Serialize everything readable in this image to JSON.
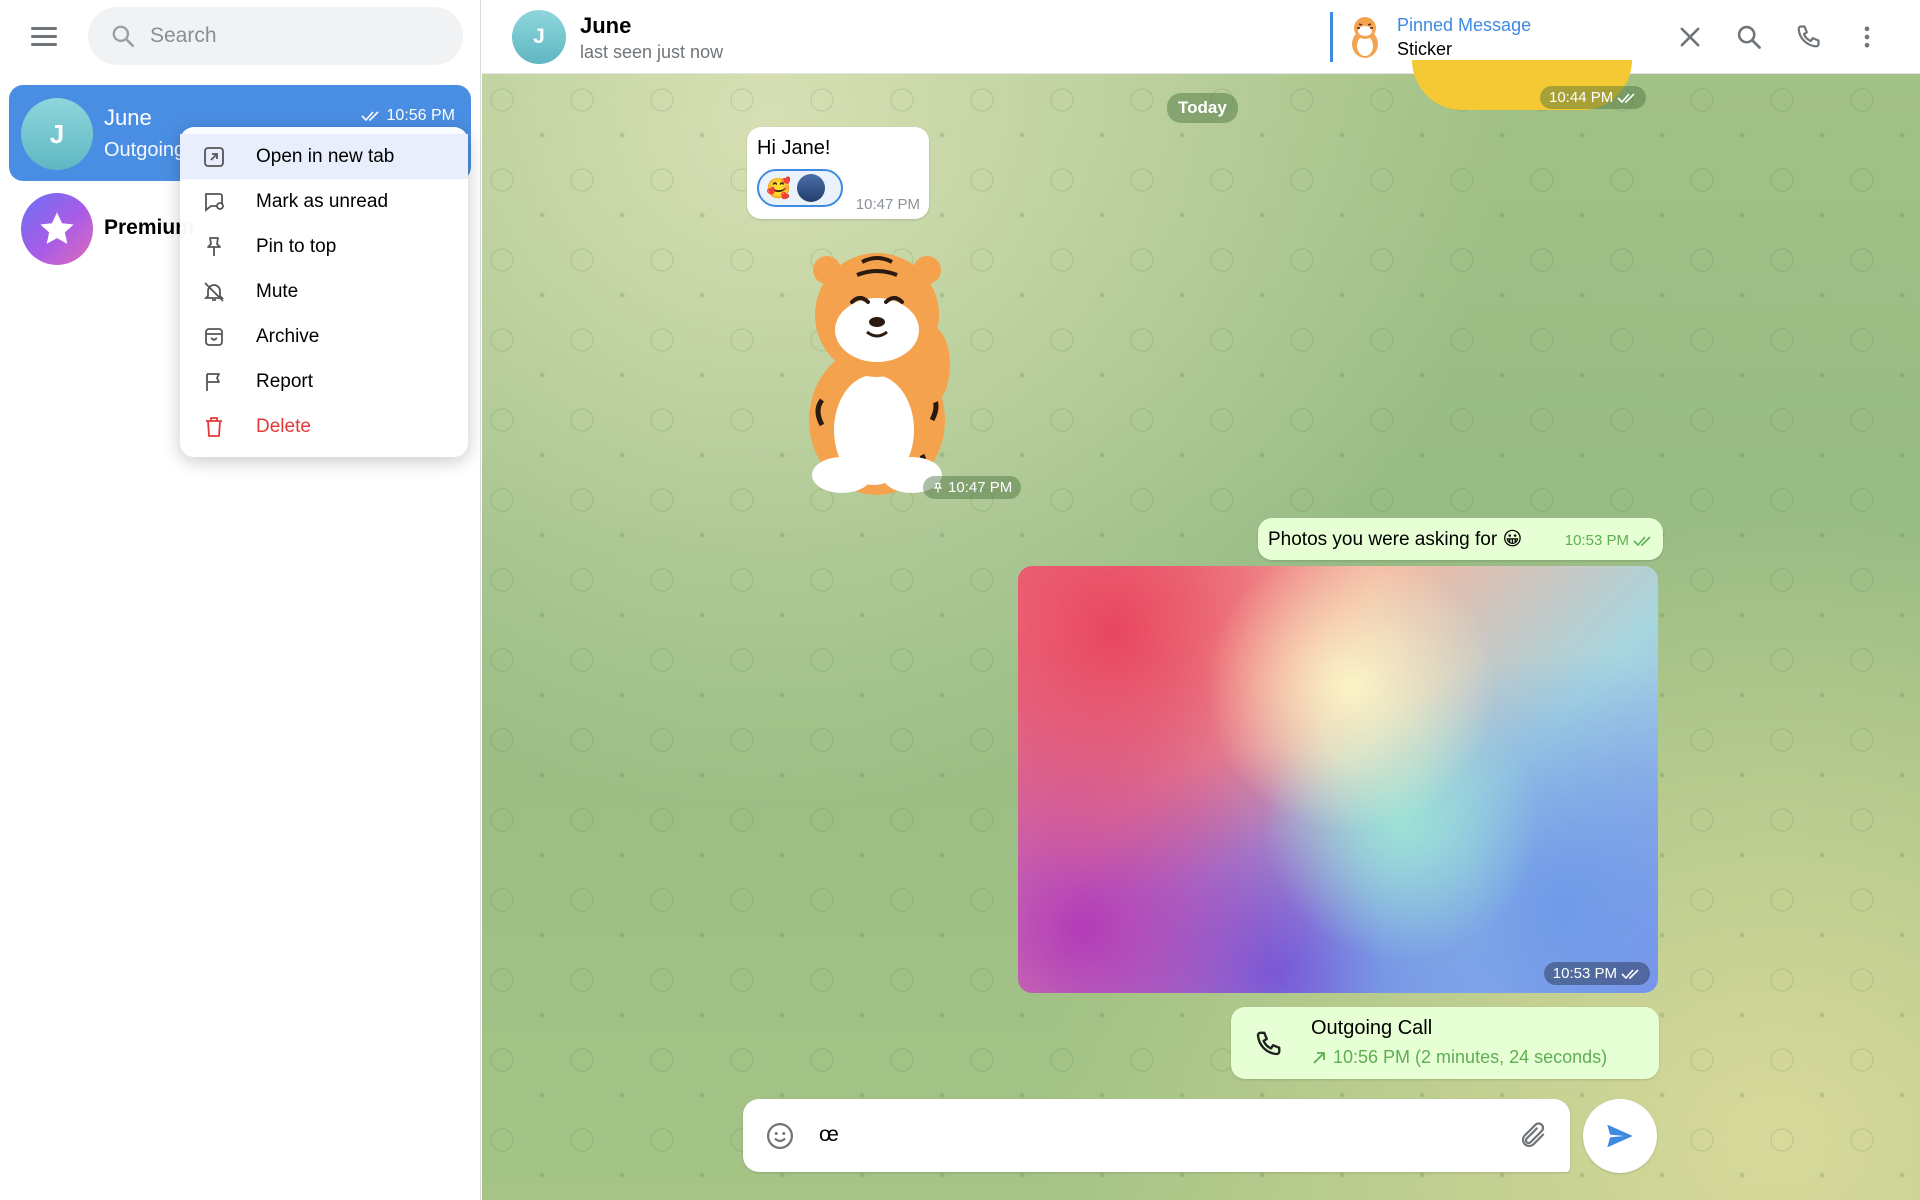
{
  "sidebar": {
    "search_placeholder": "Search",
    "chats": [
      {
        "name": "June",
        "initial": "J",
        "subtitle": "Outgoing",
        "time": "10:56 PM",
        "selected": true
      },
      {
        "name": "Premium",
        "icon": "star-icon"
      }
    ]
  },
  "context_menu": {
    "items": [
      {
        "label": "Open in new tab",
        "icon": "open-new-tab-icon"
      },
      {
        "label": "Mark as unread",
        "icon": "mark-unread-icon"
      },
      {
        "label": "Pin to top",
        "icon": "pin-icon"
      },
      {
        "label": "Mute",
        "icon": "mute-icon"
      },
      {
        "label": "Archive",
        "icon": "archive-icon"
      },
      {
        "label": "Report",
        "icon": "flag-icon"
      },
      {
        "label": "Delete",
        "icon": "trash-icon",
        "color": "#e53935"
      }
    ]
  },
  "header": {
    "name": "June",
    "initial": "J",
    "status": "last seen just now",
    "pinned_title": "Pinned Message",
    "pinned_text": "Sticker"
  },
  "messages": {
    "date_separator": "Today",
    "top_sticker_time": "10:44 PM",
    "hi_text": "Hi Jane!",
    "hi_reaction_emoji": "🥰",
    "hi_time": "10:47 PM",
    "sticker_time": "10:47 PM",
    "photos_text": "Photos you were asking for 😀",
    "photos_text_time": "10:53 PM",
    "photo_time": "10:53 PM",
    "call_title": "Outgoing Call",
    "call_detail": "10:56 PM (2 minutes, 24 seconds)"
  },
  "composer": {
    "value": "œ"
  },
  "colors": {
    "accent": "#3f8ae0",
    "selected_chat": "#4a8ee3",
    "outgoing_bubble": "#e6ffd4",
    "danger": "#e53935"
  }
}
